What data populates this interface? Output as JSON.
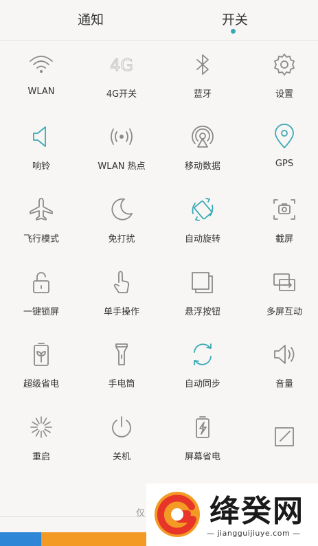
{
  "tabs": [
    {
      "label": "通知",
      "active": false
    },
    {
      "label": "开关",
      "active": true
    }
  ],
  "accent_color": "#3aa9b5",
  "toggles": [
    {
      "label": "WLAN",
      "icon": "wifi-icon",
      "active": false
    },
    {
      "label": "4G开关",
      "icon": "4g-icon",
      "active": false,
      "icon_text": "4G"
    },
    {
      "label": "蓝牙",
      "icon": "bluetooth-icon",
      "active": false
    },
    {
      "label": "设置",
      "icon": "gear-icon",
      "active": false
    },
    {
      "label": "响铃",
      "icon": "speaker-icon",
      "active": true
    },
    {
      "label": "WLAN 热点",
      "icon": "hotspot-icon",
      "active": false
    },
    {
      "label": "移动数据",
      "icon": "mobile-data-icon",
      "active": false
    },
    {
      "label": "GPS",
      "icon": "location-pin-icon",
      "active": true
    },
    {
      "label": "飞行模式",
      "icon": "airplane-icon",
      "active": false
    },
    {
      "label": "免打扰",
      "icon": "moon-icon",
      "active": false
    },
    {
      "label": "自动旋转",
      "icon": "rotate-icon",
      "active": true
    },
    {
      "label": "截屏",
      "icon": "screenshot-icon",
      "active": false
    },
    {
      "label": "一键锁屏",
      "icon": "lock-icon",
      "active": false
    },
    {
      "label": "单手操作",
      "icon": "hand-icon",
      "active": false
    },
    {
      "label": "悬浮按钮",
      "icon": "floating-button-icon",
      "active": false
    },
    {
      "label": "多屏互动",
      "icon": "multi-screen-icon",
      "active": false
    },
    {
      "label": "超级省电",
      "icon": "battery-leaf-icon",
      "active": false
    },
    {
      "label": "手电筒",
      "icon": "flashlight-icon",
      "active": false
    },
    {
      "label": "自动同步",
      "icon": "sync-icon",
      "active": true
    },
    {
      "label": "音量",
      "icon": "volume-icon",
      "active": false
    },
    {
      "label": "重启",
      "icon": "restart-icon",
      "active": false
    },
    {
      "label": "关机",
      "icon": "power-icon",
      "active": false
    },
    {
      "label": "屏幕省电",
      "icon": "battery-bolt-icon",
      "active": false
    },
    {
      "label": "",
      "icon": "edit-icon",
      "active": false
    }
  ],
  "bottom_hint": "仅",
  "watermark": {
    "title": "绛癸网",
    "subtitle": "— jiangguijiuye.com —"
  }
}
